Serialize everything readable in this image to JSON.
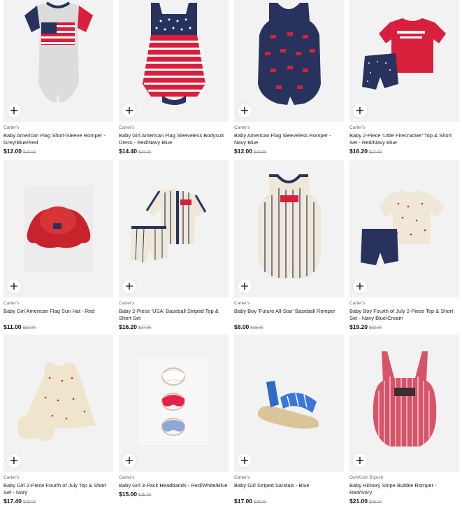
{
  "products": [
    {
      "brand": "Carter's",
      "title": "Baby American Flag Short-Sleeve Romper - Grey/Blue/Red",
      "price": "$12.00",
      "was": "$20.00",
      "icon": "romper-flag-grey"
    },
    {
      "brand": "Carter's",
      "title": "Baby Girl American Flag Sleeveless Bodysuit Dress - Red/Navy Blue",
      "price": "$14.40",
      "was": "$24.00",
      "icon": "dress-stars-stripes"
    },
    {
      "brand": "Carter's",
      "title": "Baby American Flag Sleeveless Romper - Navy Blue",
      "price": "$12.00",
      "was": "$20.00",
      "icon": "romper-navy"
    },
    {
      "brand": "Carter's",
      "title": "Baby 2-Piece 'Little Firecracker' Top & Short Set - Red/Navy Blue",
      "price": "$16.20",
      "was": "$27.00",
      "icon": "tee-short-set"
    },
    {
      "brand": "Carter's",
      "title": "Baby Girl American Flag Sun Hat - Red",
      "price": "$11.00",
      "was": "$22.00",
      "icon": "sun-hat"
    },
    {
      "brand": "Carter's",
      "title": "Baby 2-Piece 'USA' Baseball Striped Top & Short Set",
      "price": "$16.20",
      "was": "$27.00",
      "icon": "baseball-set"
    },
    {
      "brand": "Carter's",
      "title": "Baby Boy 'Future All-Star' Baseball Romper",
      "price": "$8.00",
      "was": "$18.00",
      "icon": "striped-romper"
    },
    {
      "brand": "Carter's",
      "title": "Baby Boy Fourth of July 2-Piece Top & Short Set - Navy Blue/Cream",
      "price": "$19.20",
      "was": "$32.00",
      "icon": "shirt-short-set"
    },
    {
      "brand": "Carter's",
      "title": "Baby Girl 2-Piece Fourth of July Top & Short Set - Ivory",
      "price": "$17.40",
      "was": "$29.00",
      "icon": "ivory-set"
    },
    {
      "brand": "Carter's",
      "title": "Baby Girl 3-Pack Headbands - Red/White/Blue",
      "price": "$15.00",
      "was": "$25.00",
      "icon": "headbands"
    },
    {
      "brand": "Carter's",
      "title": "Baby Girl Striped Sandals - Blue",
      "price": "$17.00",
      "was": "$28.00",
      "icon": "sandals"
    },
    {
      "brand": "OshKosh B'gosh",
      "title": "Baby Hickory Stripe Bubble Romper - Red/Ivory",
      "price": "$21.00",
      "was": "$35.00",
      "icon": "bubble-romper"
    }
  ],
  "add_button_label": "+",
  "colors": {
    "navy": "#27335c",
    "red": "#d81f3c",
    "grey": "#dcdcdc",
    "ivory": "#efe8d8"
  }
}
